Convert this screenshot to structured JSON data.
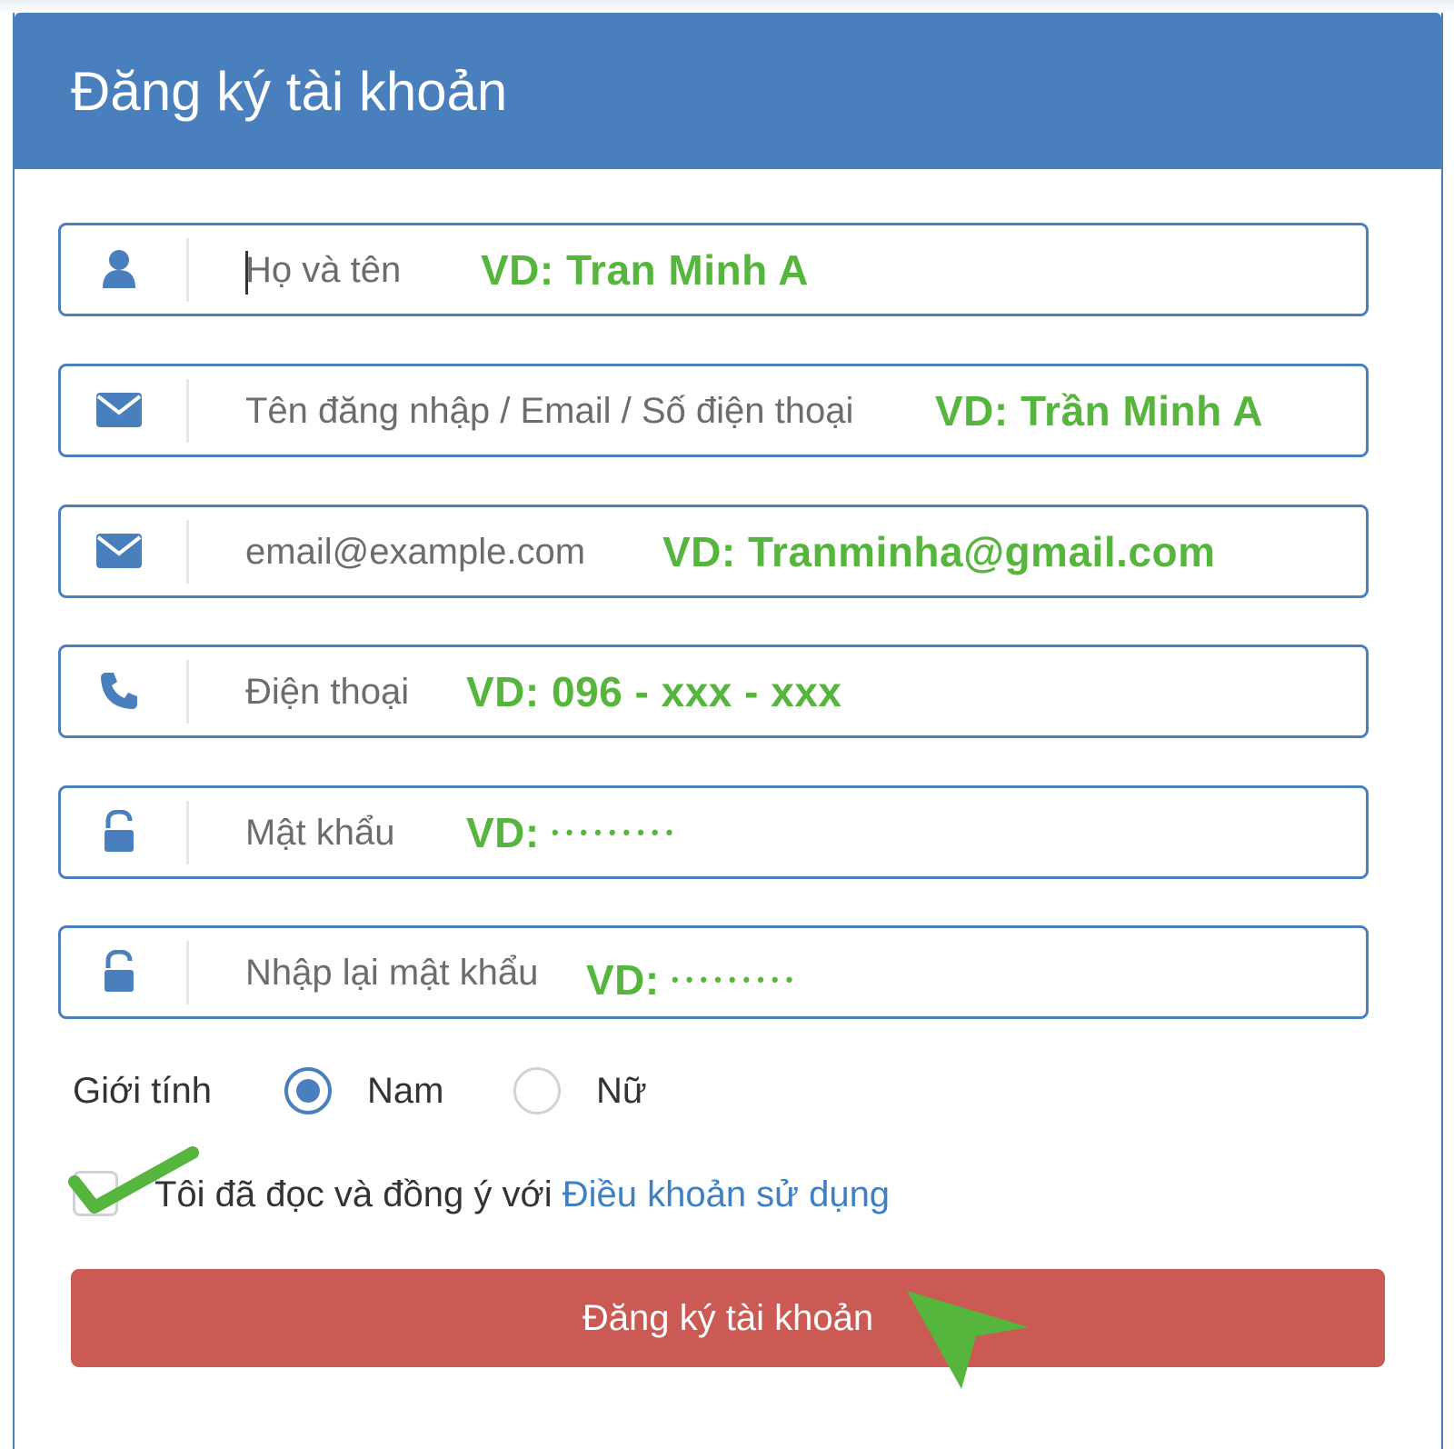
{
  "header": {
    "title": "Đăng ký tài khoản"
  },
  "fields": [
    {
      "icon": "user-icon",
      "placeholder": "Họ và tên",
      "hint": "VD: Tran Minh A"
    },
    {
      "icon": "envelope-icon",
      "placeholder": "Tên đăng nhập / Email / Số điện thoại",
      "hint": "VD: Trần Minh A"
    },
    {
      "icon": "envelope-icon",
      "placeholder": "email@example.com",
      "hint": "VD: Tranminha@gmail.com"
    },
    {
      "icon": "phone-icon",
      "placeholder": "Điện thoại",
      "hint": "VD: 096 - xxx - xxx"
    },
    {
      "icon": "unlock-icon",
      "placeholder": "Mật khẩu",
      "hint_prefix": "VD:",
      "hint_dots": "•••••••••"
    },
    {
      "icon": "unlock-icon",
      "placeholder": "Nhập lại mật khẩu",
      "hint_prefix": "VD:",
      "hint_dots": "•••••••••"
    }
  ],
  "gender": {
    "label": "Giới tính",
    "options": [
      {
        "label": "Nam",
        "selected": true
      },
      {
        "label": "Nữ",
        "selected": false
      }
    ]
  },
  "terms": {
    "text": "Tôi đã đọc và đồng ý với ",
    "link": "Điều khoản sử dụng",
    "checked": true
  },
  "submit": {
    "label": "Đăng ký tài khoản"
  },
  "colors": {
    "primary": "#4a7fbd",
    "hint_green": "#56b53c",
    "submit_red": "#cc5a54",
    "link_blue": "#3f7fc4"
  }
}
